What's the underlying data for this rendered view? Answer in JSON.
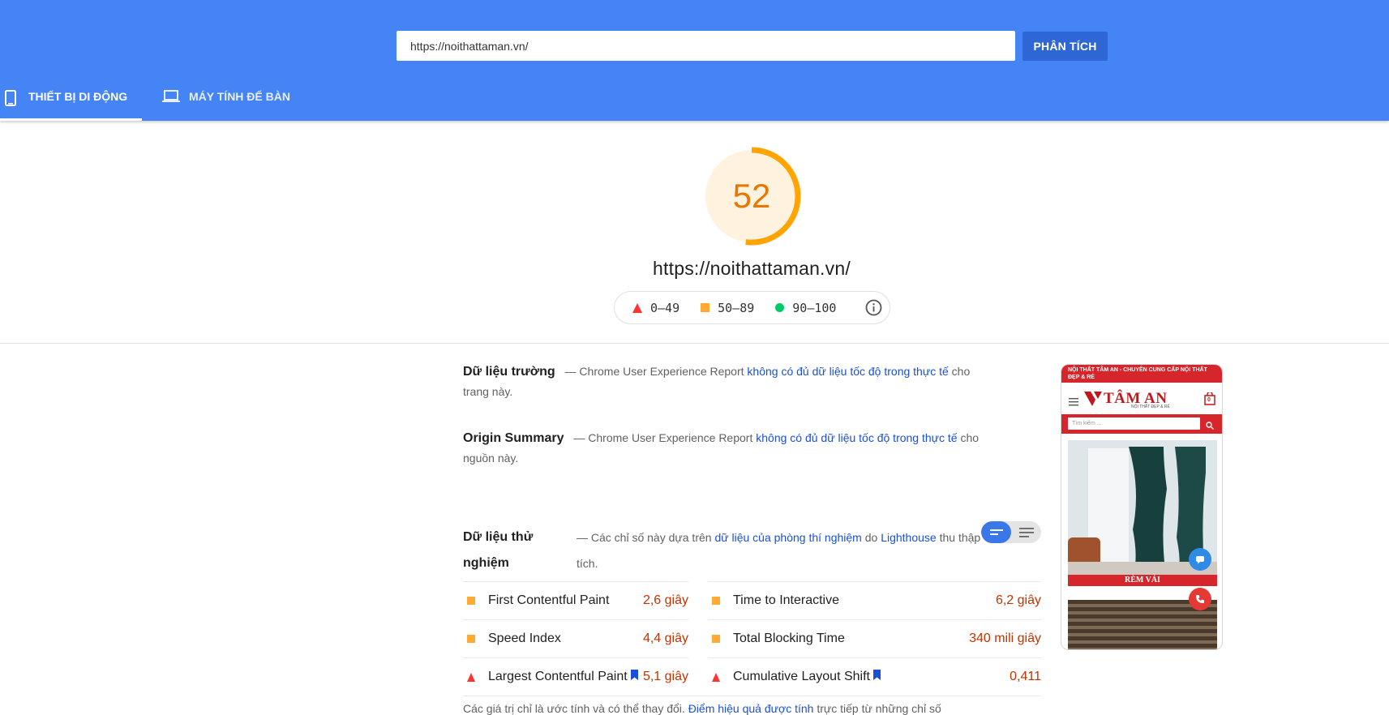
{
  "header": {
    "url_value": "https://noithattaman.vn/",
    "analyze_label": "PHÂN TÍCH",
    "tabs": [
      {
        "label": "THIẾT BỊ DI ĐỘNG",
        "icon": "smartphone-icon",
        "active": true
      },
      {
        "label": "MÁY TÍNH ĐỂ BÀN",
        "icon": "laptop-icon",
        "active": false
      }
    ]
  },
  "score": {
    "value": "52",
    "fraction": 0.52,
    "color": "#ffa400",
    "url": "https://noithattaman.vn/",
    "legend": [
      {
        "label": "0–49",
        "shape": "triangle",
        "color": "#ff3333"
      },
      {
        "label": "50–89",
        "shape": "square",
        "color": "#ffaa33"
      },
      {
        "label": "90–100",
        "shape": "circle",
        "color": "#00cc66"
      }
    ]
  },
  "field_data": {
    "title": "Dữ liệu trường",
    "prefix": "— Chrome User Experience Report",
    "link": "không có đủ dữ liệu tốc độ trong thực tế",
    "suffix": "cho trang này."
  },
  "origin_summary": {
    "title": "Origin Summary",
    "prefix": "— Chrome User Experience Report",
    "link": "không có đủ dữ liệu tốc độ trong thực tế",
    "suffix": "cho nguồn này."
  },
  "lab_data": {
    "title": "Dữ liệu thử nghiệm",
    "prefix": "— Các chỉ số này dựa trên",
    "link1": "dữ liệu của phòng thí nghiệm",
    "middle": "do",
    "link2": "Lighthouse",
    "suffix": "thu thập",
    "line2": "tích.",
    "metrics": [
      {
        "name": "First Contentful Paint",
        "value": "2,6 giây",
        "status": "average",
        "bookmark": false
      },
      {
        "name": "Time to Interactive",
        "value": "6,2 giây",
        "status": "average",
        "bookmark": false
      },
      {
        "name": "Speed Index",
        "value": "4,4 giây",
        "status": "average",
        "bookmark": false
      },
      {
        "name": "Total Blocking Time",
        "value": "340 mili giây",
        "status": "average",
        "bookmark": false
      },
      {
        "name": "Largest Contentful Paint",
        "value": "5,1 giây",
        "status": "fail",
        "bookmark": true
      },
      {
        "name": "Cumulative Layout Shift",
        "value": "0,411",
        "status": "fail",
        "bookmark": true
      }
    ],
    "footnote_prefix": "Các giá trị chỉ là ước tính và có thể thay đổi.",
    "footnote_link": "Điểm hiệu quả được tính",
    "footnote_suffix": "trực tiếp từ những chỉ số"
  },
  "preview": {
    "topbar": "NỘI THẤT TÂM AN - CHUYÊN CUNG CẤP NỘI THẤT ĐẸP & RẺ",
    "brand": "TÂM AN",
    "brand_sub": "NỘI THẤT ĐẸP & RẺ",
    "cart_count": "0",
    "search_placeholder": "Tìm kiếm ...",
    "caption": "RÈM VẢI",
    "accent": "#d7262b"
  }
}
